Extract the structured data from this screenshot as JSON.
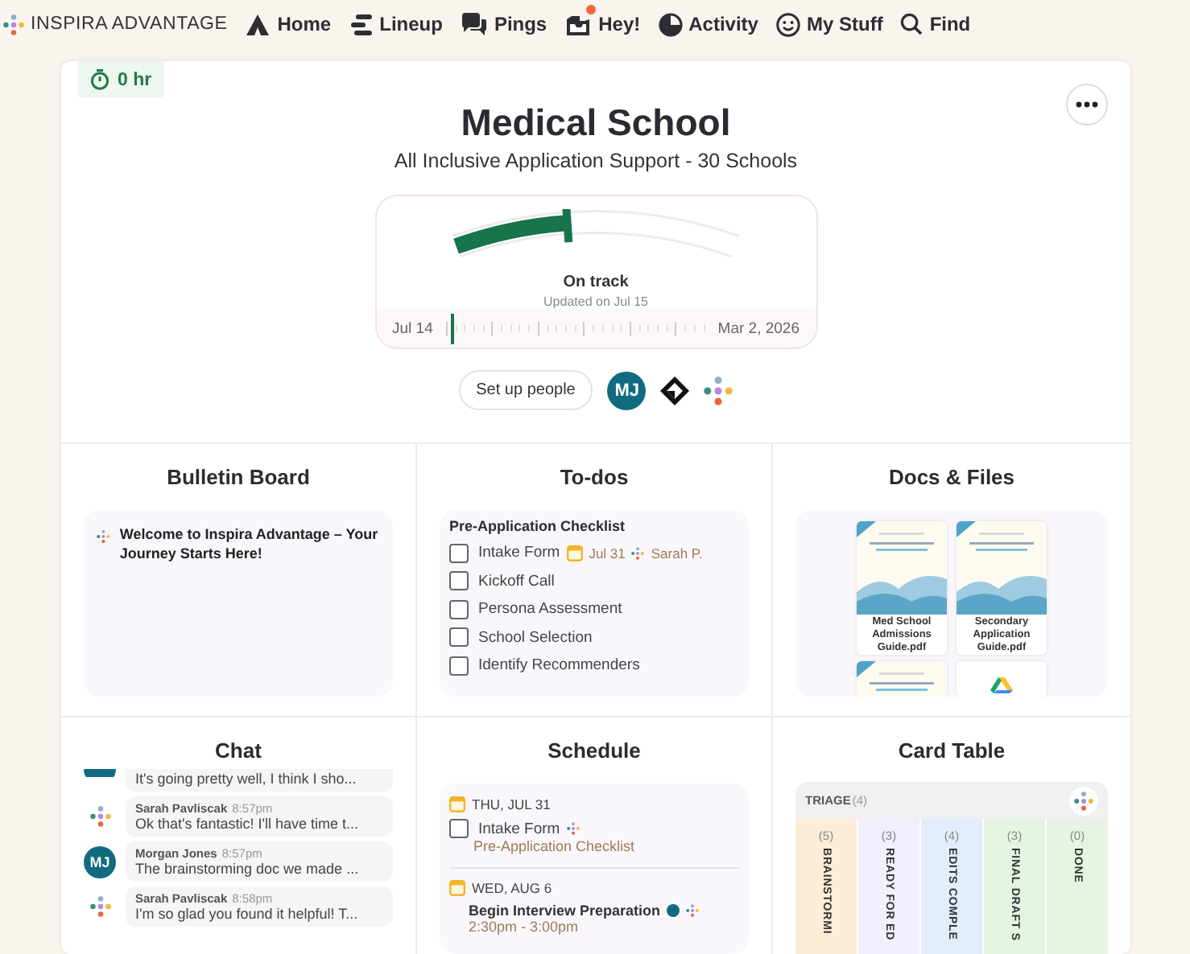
{
  "nav": {
    "brand": "INSPIRA ADVANTAGE",
    "items": [
      {
        "label": "Home",
        "kind": "home",
        "badge": false
      },
      {
        "label": "Lineup",
        "kind": "lineup",
        "badge": false
      },
      {
        "label": "Pings",
        "kind": "pings",
        "badge": false
      },
      {
        "label": "Hey!",
        "kind": "hey",
        "badge": true
      },
      {
        "label": "Activity",
        "kind": "activity",
        "badge": false
      },
      {
        "label": "My Stuff",
        "kind": "smiley",
        "badge": false
      },
      {
        "label": "Find",
        "kind": "search",
        "badge": false
      }
    ]
  },
  "timer": "0 hr",
  "project": {
    "title": "Medical School",
    "subtitle": "All Inclusive Application Support - 30 Schools"
  },
  "progress": {
    "level": 0.4,
    "status": "On track",
    "updated": "Updated on Jul 15"
  },
  "timeline": {
    "start": "Jul 14",
    "end": "Mar 2, 2026",
    "level": 0.02
  },
  "people": {
    "button": "Set up people",
    "avatars": [
      {
        "kind": "initials",
        "text": "MJ"
      },
      {
        "kind": "mark"
      },
      {
        "kind": "dots"
      }
    ]
  },
  "bulletin": {
    "title": "Bulletin Board",
    "posts": [
      "Welcome to Inspira Advantage – Your Journey Starts Here!"
    ]
  },
  "todos": {
    "title": "To-dos",
    "list": "Pre-Application Checklist",
    "items": [
      {
        "label": "Intake Form",
        "checked": false,
        "due": "Jul 31",
        "assignee": "Sarah P."
      },
      {
        "label": "Kickoff Call",
        "checked": false
      },
      {
        "label": "Persona Assessment",
        "checked": false
      },
      {
        "label": "School Selection",
        "checked": false
      },
      {
        "label": "Identify Recommenders",
        "checked": false
      }
    ]
  },
  "docs": {
    "title": "Docs & Files",
    "files": [
      {
        "name": "Med School Admissions Guide.pdf",
        "kind": "pdf"
      },
      {
        "name": "Secondary Application Guide.pdf",
        "kind": "pdf"
      },
      {
        "kind": "pdf"
      },
      {
        "kind": "drive"
      }
    ]
  },
  "chat": {
    "title": "Chat",
    "messages": [
      {
        "kind": "partial",
        "text": "It's going pretty well, I think I sho..."
      },
      {
        "kind": "dots",
        "author": "Sarah Pavliscak",
        "time": "8:57pm",
        "text": "Ok that's fantastic! I'll have time t..."
      },
      {
        "kind": "initials",
        "initials": "MJ",
        "author": "Morgan Jones",
        "time": "8:57pm",
        "text": "The brainstorming doc we made ..."
      },
      {
        "kind": "dots",
        "author": "Sarah Pavliscak",
        "time": "8:58pm",
        "text": "I'm so glad you found it helpful! T..."
      }
    ]
  },
  "schedule": {
    "title": "Schedule",
    "days": [
      {
        "date": "THU, JUL 31",
        "items": [
          {
            "kind": "todo",
            "title": "Intake Form",
            "checked": false,
            "detail": "Pre-Application Checklist"
          }
        ]
      },
      {
        "date": "WED, AUG 6",
        "items": [
          {
            "kind": "event",
            "title": "Begin Interview Preparation",
            "detail": "2:30pm - 3:00pm"
          }
        ]
      }
    ]
  },
  "card_table": {
    "title": "Card Table",
    "triage": "TRIAGE",
    "triage_count": "(4)",
    "columns": [
      {
        "count": "(5)",
        "name": "BRAINSTORMI",
        "color": "#fdecd6"
      },
      {
        "count": "(3)",
        "name": "READY FOR ED",
        "color": "#f2eefb"
      },
      {
        "count": "(4)",
        "name": "EDITS COMPLE",
        "color": "#e3ecfb"
      },
      {
        "count": "(3)",
        "name": "FINAL DRAFT S",
        "color": "#e5f3e1"
      },
      {
        "count": "(0)",
        "name": "DONE",
        "color": "#e7f4e3"
      }
    ]
  }
}
